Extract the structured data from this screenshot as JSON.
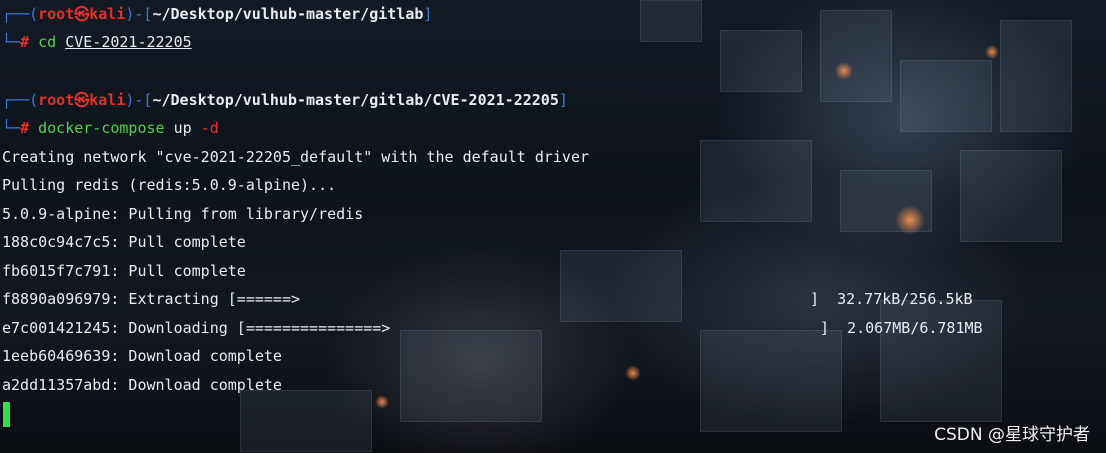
{
  "prompts": [
    {
      "frame_left": "┌──(",
      "user": "root㉿kali",
      "frame_mid": ")-[",
      "path": "~/Desktop/vulhub-master/gitlab",
      "frame_right": "]",
      "corner": "└─",
      "hash": "#",
      "command": "cd",
      "argument": "CVE-2021-22205",
      "flag": ""
    },
    {
      "frame_left": "┌──(",
      "user": "root㉿kali",
      "frame_mid": ")-[",
      "path": "~/Desktop/vulhub-master/gitlab/CVE-2021-22205",
      "frame_right": "]",
      "corner": "└─",
      "hash": "#",
      "command": "docker-compose",
      "argument": "up",
      "flag": "-d"
    }
  ],
  "output": [
    {
      "left": "Creating network \"cve-2021-22205_default\" with the default driver",
      "right": ""
    },
    {
      "left": "Pulling redis (redis:5.0.9-alpine)...",
      "right": ""
    },
    {
      "left": "5.0.9-alpine: Pulling from library/redis",
      "right": ""
    },
    {
      "left": "188c0c94c7c5: Pull complete",
      "right": ""
    },
    {
      "left": "fb6015f7c791: Pull complete",
      "right": ""
    },
    {
      "left": "f8890a096979: Extracting [======>",
      "right": "]  32.77kB/256.5kB"
    },
    {
      "left": "e7c001421245: Downloading [===============>",
      "right": "]  2.067MB/6.781MB"
    },
    {
      "left": "1eeb60469639: Download complete",
      "right": ""
    },
    {
      "left": "a2dd11357abd: Download complete",
      "right": ""
    }
  ],
  "watermark": "CSDN @星球守护者",
  "colors": {
    "frame": "#3b78d6",
    "user": "#e0302b",
    "command": "#4fd14b",
    "cursor": "#2fe04a",
    "text": "#e8ecf2"
  }
}
